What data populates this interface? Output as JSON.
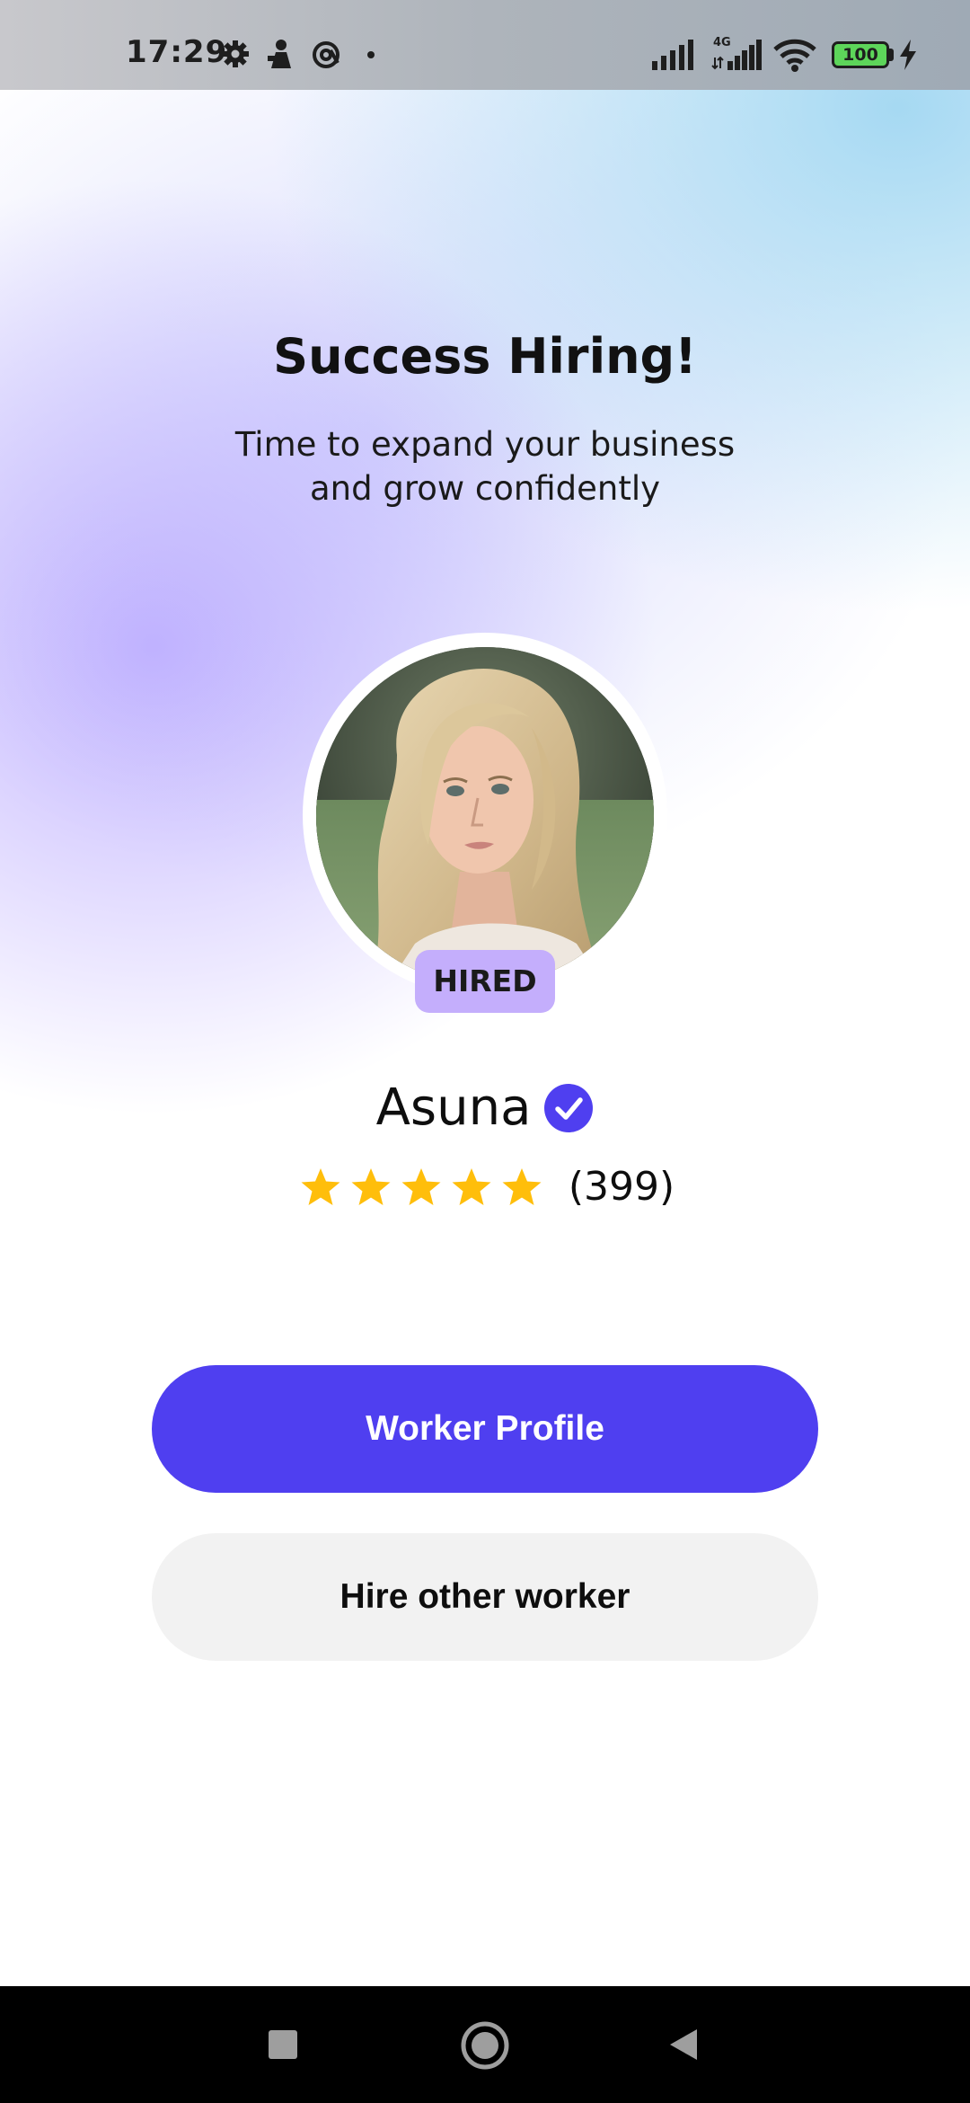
{
  "status_bar": {
    "time": "17:29",
    "battery": "100",
    "network": "4G",
    "icons": [
      "gear-icon",
      "person-pin-icon",
      "at-sign-icon",
      "dot-icon",
      "signal-icon",
      "signal-4g-icon",
      "wifi-icon",
      "battery-icon",
      "charging-bolt-icon"
    ]
  },
  "header": {
    "title": "Success Hiring!",
    "subtitle_line1": "Time to expand your business",
    "subtitle_line2": "and grow confidently"
  },
  "worker": {
    "badge": "HIRED",
    "name": "Asuna",
    "verified": true,
    "rating_stars": 5,
    "review_count": "(399)"
  },
  "actions": {
    "primary_label": "Worker Profile",
    "secondary_label": "Hire other worker"
  },
  "colors": {
    "primary": "#4f3ff0",
    "badge": "#c4aefc",
    "star": "#ffbe0b",
    "verified": "#4f3ff0"
  },
  "nav_bar": {
    "icons": [
      "recent-apps-icon",
      "home-icon",
      "back-icon"
    ]
  }
}
